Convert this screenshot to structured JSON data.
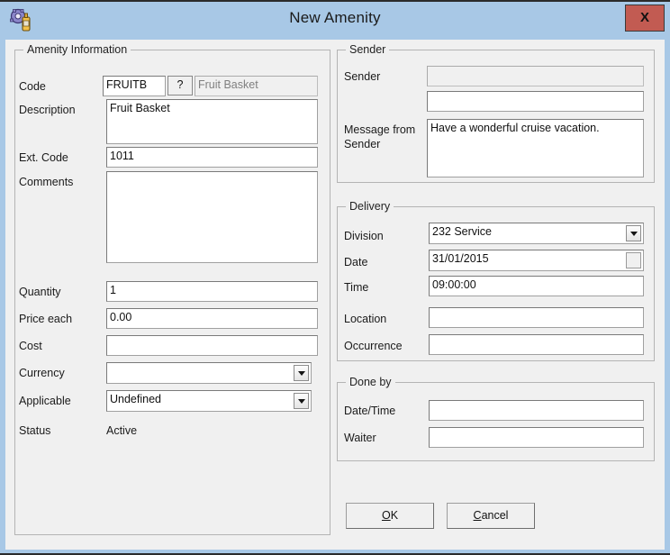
{
  "window": {
    "title": "New Amenity",
    "icon": "amenity-gear-icon",
    "close_label": "X",
    "accent_title_bar": "#a8c8e6",
    "close_button_color": "#c25b52"
  },
  "amenity_information": {
    "group_title": "Amenity Information",
    "code": {
      "label": "Code",
      "value": "FRUITB",
      "lookup_button": "?",
      "description_readonly": "Fruit Basket"
    },
    "description": {
      "label": "Description",
      "value": "Fruit Basket"
    },
    "ext_code": {
      "label": "Ext. Code",
      "value": "1011"
    },
    "comments": {
      "label": "Comments",
      "value": ""
    },
    "quantity": {
      "label": "Quantity",
      "value": "1"
    },
    "price_each": {
      "label": "Price each",
      "value": "0.00"
    },
    "cost": {
      "label": "Cost",
      "value": ""
    },
    "currency": {
      "label": "Currency",
      "value": ""
    },
    "applicable": {
      "label": "Applicable",
      "value": "Undefined"
    },
    "status": {
      "label": "Status",
      "value": "Active"
    }
  },
  "sender": {
    "group_title": "Sender",
    "sender": {
      "label": "Sender",
      "value": ""
    },
    "sender_second": {
      "label": "",
      "value": ""
    },
    "message": {
      "label": "Message from\nSender",
      "label_line1": "Message from",
      "label_line2": "Sender",
      "value": "Have a wonderful cruise vacation."
    }
  },
  "delivery": {
    "group_title": "Delivery",
    "division": {
      "label": "Division",
      "value": "232 Service"
    },
    "date": {
      "label": "Date",
      "value": "31/01/2015"
    },
    "time": {
      "label": "Time",
      "value": "09:00:00"
    },
    "location": {
      "label": "Location",
      "value": ""
    },
    "occurrence": {
      "label": "Occurrence",
      "value": ""
    }
  },
  "done_by": {
    "group_title": "Done by",
    "date_time": {
      "label": "Date/Time",
      "value": ""
    },
    "waiter": {
      "label": "Waiter",
      "value": ""
    }
  },
  "actions": {
    "ok": {
      "accel": "O",
      "rest": "K"
    },
    "cancel": {
      "accel": "C",
      "rest": "ancel"
    }
  }
}
